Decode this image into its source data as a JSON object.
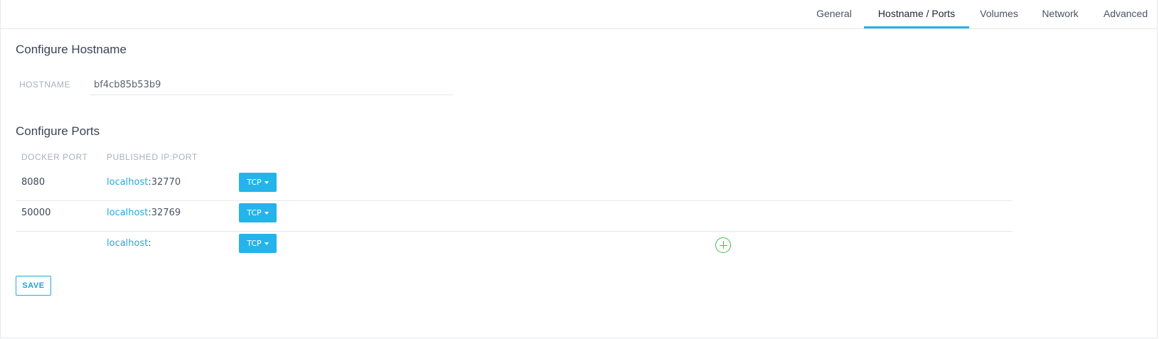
{
  "tabs": {
    "general": "General",
    "hostname_ports": "Hostname / Ports",
    "volumes": "Volumes",
    "network": "Network",
    "advanced": "Advanced",
    "active": "hostname_ports"
  },
  "hostname": {
    "title": "Configure Hostname",
    "label": "HOSTNAME",
    "value": "bf4cb85b53b9"
  },
  "ports": {
    "title": "Configure Ports",
    "col_docker": "DOCKER PORT",
    "col_published": "PUBLISHED IP:PORT",
    "rows": [
      {
        "docker": "8080",
        "host": "localhost",
        "sep": ":",
        "port": "32770",
        "protocol": "TCP"
      },
      {
        "docker": "50000",
        "host": "localhost",
        "sep": ":",
        "port": "32769",
        "protocol": "TCP"
      },
      {
        "docker": "",
        "host": "localhost",
        "sep": ":",
        "port": "",
        "protocol": "TCP"
      }
    ],
    "add_icon": "plus-circle-icon"
  },
  "actions": {
    "save": "SAVE"
  },
  "colors": {
    "accent": "#24b4ea",
    "add": "#39c34f"
  }
}
